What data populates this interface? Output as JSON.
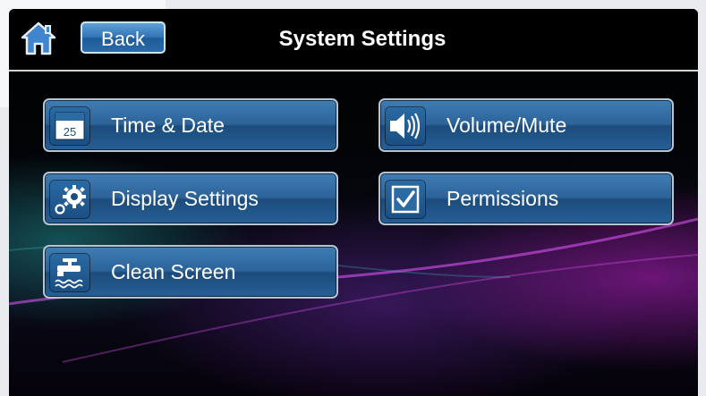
{
  "header": {
    "home_icon": "home-icon",
    "back_label": "Back",
    "title": "System Settings"
  },
  "menu": {
    "time_date": {
      "label": "Time & Date",
      "icon": "calendar-icon",
      "calendar_day": "25"
    },
    "volume_mute": {
      "label": "Volume/Mute",
      "icon": "speaker-icon"
    },
    "display_settings": {
      "label": "Display Settings",
      "icon": "gears-icon"
    },
    "permissions": {
      "label": "Permissions",
      "icon": "checkbox-icon"
    },
    "clean_screen": {
      "label": "Clean Screen",
      "icon": "faucet-icon"
    }
  },
  "colors": {
    "button_blue": "#2c6399",
    "home_blue": "#3f86cf",
    "header_bg": "#000000",
    "accent_magenta": "#be1ec8",
    "accent_teal": "#1e8c8c"
  }
}
